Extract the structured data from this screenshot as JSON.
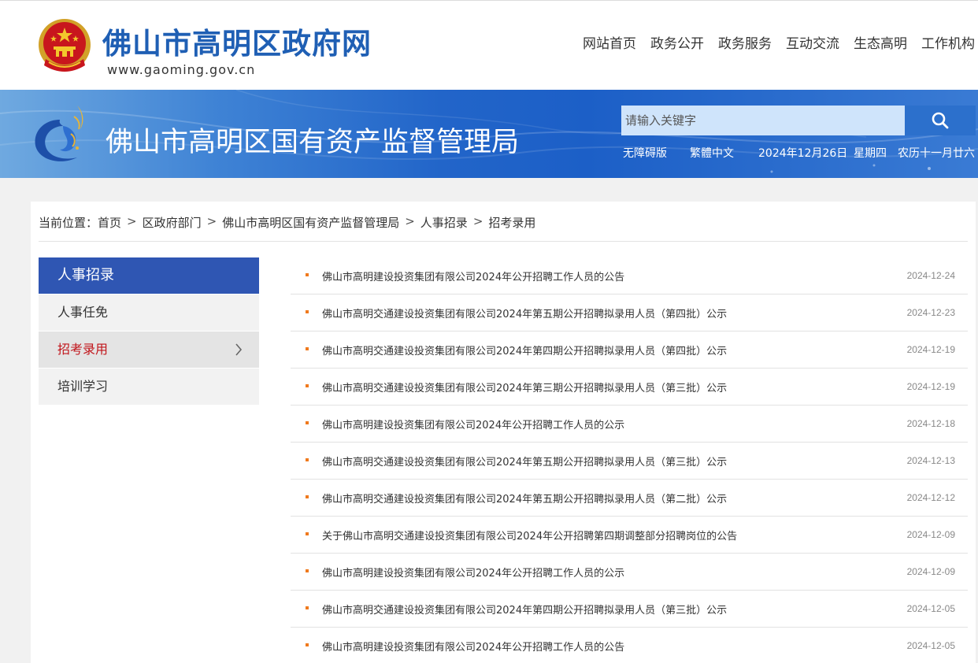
{
  "header": {
    "site_title": "佛山市高明区政府网",
    "site_url": "www.gaoming.gov.cn",
    "nav": [
      "网站首页",
      "政务公开",
      "政务服务",
      "互动交流",
      "生态高明",
      "工作机构"
    ]
  },
  "banner": {
    "dept_title": "佛山市高明区国有资产监督管理局",
    "search_placeholder": "请输入关键字",
    "accessibility": "无障碍版",
    "traditional": "繁體中文",
    "date": "2024年12月26日",
    "weekday": "星期四",
    "lunar": "农历十一月廿六"
  },
  "breadcrumb": {
    "label": "当前位置：",
    "items": [
      "首页",
      "区政府部门",
      "佛山市高明区国有资产监督管理局",
      "人事招录",
      "招考录用"
    ],
    "separator": ">"
  },
  "sidebar": {
    "heading": "人事招录",
    "items": [
      {
        "label": "人事任免"
      },
      {
        "label": "招考录用"
      },
      {
        "label": "培训学习"
      }
    ],
    "active_index": 1
  },
  "articles": [
    {
      "title": "佛山市高明建设投资集团有限公司2024年公开招聘工作人员的公告",
      "date": "2024-12-24"
    },
    {
      "title": "佛山市高明交通建设投资集团有限公司2024年第五期公开招聘拟录用人员（第四批）公示",
      "date": "2024-12-23"
    },
    {
      "title": "佛山市高明交通建设投资集团有限公司2024年第四期公开招聘拟录用人员（第四批）公示",
      "date": "2024-12-19"
    },
    {
      "title": "佛山市高明交通建设投资集团有限公司2024年第三期公开招聘拟录用人员（第三批）公示",
      "date": "2024-12-19"
    },
    {
      "title": "佛山市高明建设投资集团有限公司2024年公开招聘工作人员的公示",
      "date": "2024-12-18"
    },
    {
      "title": "佛山市高明交通建设投资集团有限公司2024年第五期公开招聘拟录用人员（第三批）公示",
      "date": "2024-12-13"
    },
    {
      "title": "佛山市高明交通建设投资集团有限公司2024年第五期公开招聘拟录用人员（第二批）公示",
      "date": "2024-12-12"
    },
    {
      "title": "关于佛山市高明交通建设投资集团有限公司2024年公开招聘第四期调整部分招聘岗位的公告",
      "date": "2024-12-09"
    },
    {
      "title": "佛山市高明建设投资集团有限公司2024年公开招聘工作人员的公示",
      "date": "2024-12-09"
    },
    {
      "title": "佛山市高明交通建设投资集团有限公司2024年第四期公开招聘拟录用人员（第三批）公示",
      "date": "2024-12-05"
    },
    {
      "title": "佛山市高明建设投资集团有限公司2024年公开招聘工作人员的公告",
      "date": "2024-12-05"
    }
  ],
  "colors": {
    "brand_blue": "#1f5fb4",
    "sidebar_head": "#2f56b3",
    "active_red": "#c1141a",
    "bullet_orange": "#f07a1e"
  }
}
